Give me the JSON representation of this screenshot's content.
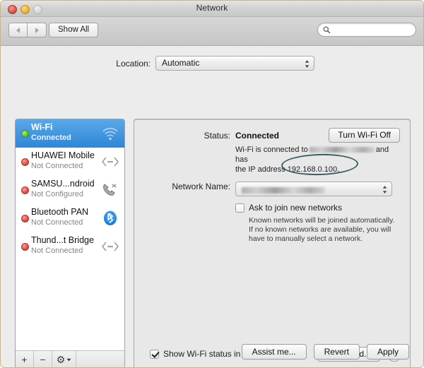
{
  "window": {
    "title": "Network",
    "traffic_lights": [
      "close",
      "minimize",
      "zoom"
    ]
  },
  "toolbar": {
    "back_label": "◀",
    "forward_label": "▶",
    "show_all_label": "Show All",
    "search_placeholder": "",
    "search_value": "",
    "search_icon": "search-icon"
  },
  "location": {
    "label": "Location:",
    "selected": "Automatic"
  },
  "sidebar": {
    "services": [
      {
        "name": "Wi-Fi",
        "status": "Connected",
        "dot": "green",
        "icon": "wifi-icon",
        "selected": true
      },
      {
        "name": "HUAWEI Mobile",
        "status": "Not Connected",
        "dot": "red",
        "icon": "ethernet-icon",
        "selected": false
      },
      {
        "name": "SAMSU...ndroid",
        "status": "Not Configured",
        "dot": "red",
        "icon": "modem-icon",
        "selected": false
      },
      {
        "name": "Bluetooth PAN",
        "status": "Not Connected",
        "dot": "red",
        "icon": "bluetooth-icon",
        "selected": false
      },
      {
        "name": "Thund...t Bridge",
        "status": "Not Connected",
        "dot": "red",
        "icon": "ethernet-icon",
        "selected": false
      }
    ],
    "footer": {
      "add_label": "+",
      "remove_label": "−",
      "gear_label": "⚙"
    }
  },
  "panel": {
    "status_label": "Status:",
    "status_value": "Connected",
    "turn_off_label": "Turn Wi-Fi Off",
    "status_desc_prefix": "Wi-Fi is connected to",
    "status_desc_middle": "and has",
    "status_desc_line2": "the IP address",
    "ip_address": "192.168.0.100.",
    "ssid_redacted": true,
    "network_name_label": "Network Name:",
    "network_name_value": "",
    "ask_join_label": "Ask to join new networks",
    "ask_join_checked": false,
    "ask_join_help": "Known networks will be joined automatically. If no known networks are available, you will have to manually select a network.",
    "show_status_label": "Show Wi-Fi status in menu bar",
    "show_status_checked": true,
    "advanced_label": "Advanced...",
    "help_label": "?"
  },
  "actions": {
    "assist_label": "Assist me...",
    "revert_label": "Revert",
    "apply_label": "Apply"
  },
  "colors": {
    "selection_blue": "#2f86d6",
    "annotation_ellipse": "#3c5f63",
    "status_green": "#5ec93c",
    "status_red": "#e2534a",
    "bluetooth_blue": "#2f86d6"
  }
}
